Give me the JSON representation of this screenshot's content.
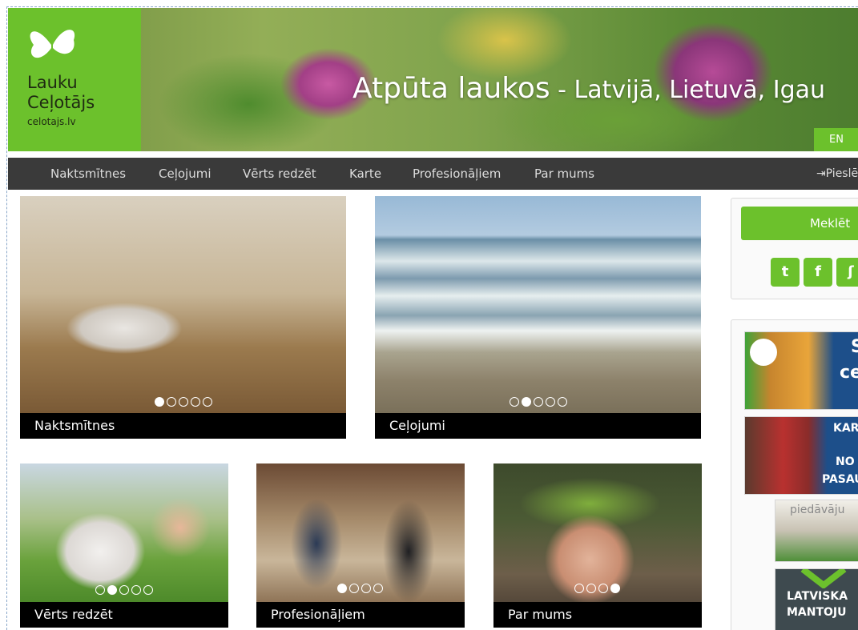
{
  "header": {
    "logo_line1": "Lauku",
    "logo_line2": "Ceļotājs",
    "logo_url": "celotajs.lv",
    "hero_main": "Atpūta laukos",
    "hero_sub": " - Latvijā, Lietuvā, Igau",
    "lang_label": "EN"
  },
  "nav": {
    "items": [
      "Naktsmītnes",
      "Ceļojumi",
      "Vērts redzēt",
      "Karte",
      "Profesionāļiem",
      "Par mums"
    ],
    "login_label": "Pieslēg"
  },
  "tiles": [
    {
      "caption": "Naktsmītnes",
      "dots_total": 5,
      "dots_active": 1
    },
    {
      "caption": "Ceļojumi",
      "dots_total": 5,
      "dots_active": 2
    },
    {
      "caption": "Vērts redzēt",
      "dots_total": 5,
      "dots_active": 2
    },
    {
      "caption": "Profesionāļiem",
      "dots_total": 4,
      "dots_active": 1
    },
    {
      "caption": "Par mums",
      "dots_total": 4,
      "dots_active": 4
    }
  ],
  "sidebar": {
    "search_label": "Meklēt",
    "social": [
      {
        "icon": "twitter-icon",
        "glyph": "t"
      },
      {
        "icon": "facebook-icon",
        "glyph": "f"
      },
      {
        "icon": "rss-icon",
        "glyph": "ʃ"
      }
    ],
    "ads": [
      {
        "line1": "S",
        "line2": "ce"
      },
      {
        "line1": "KAR",
        "line2": "NO",
        "line3": "PASAU"
      },
      {
        "line1": "piedāvāju"
      },
      {
        "line1": "LATVISKA",
        "line2": "MANTOJU"
      }
    ]
  },
  "colors": {
    "brand_green": "#6cc12c",
    "nav_bg": "#3a3a3a",
    "caption_bg": "#000000"
  }
}
